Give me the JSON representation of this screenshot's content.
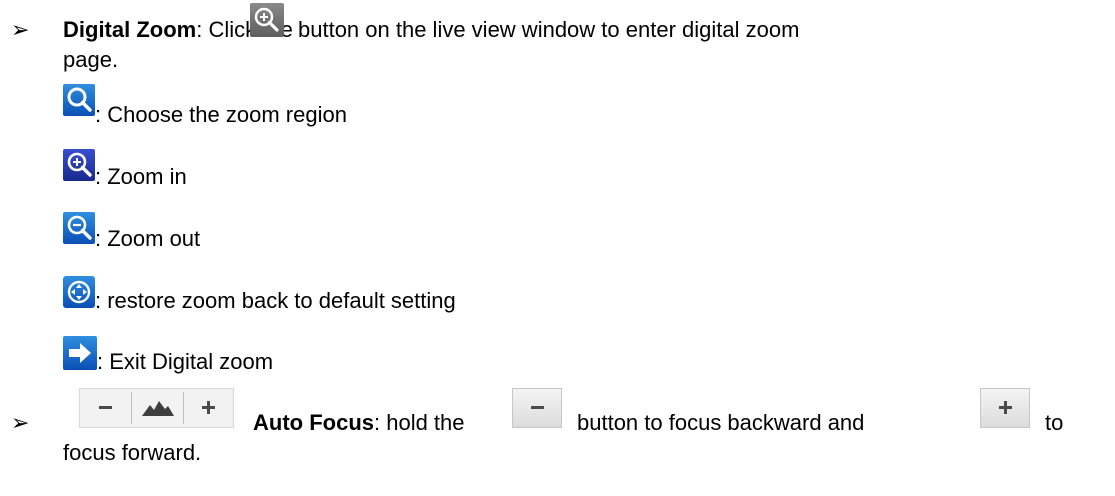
{
  "bullet_symbol": "➢",
  "digital_zoom": {
    "title": "Digital Zoom",
    "intro_pre": ": Click the",
    "intro_post": "button on the live view window to enter digital zoom",
    "intro_wrap": "page.",
    "button_icon": "zoom-in-icon",
    "items": [
      {
        "icon": "zoom-region-icon",
        "text": ": Choose the zoom region"
      },
      {
        "icon": "zoom-in-icon",
        "text": ": Zoom in"
      },
      {
        "icon": "zoom-out-icon",
        "text": ": Zoom out"
      },
      {
        "icon": "restore-icon",
        "text": ": restore zoom back to default setting"
      },
      {
        "icon": "exit-arrow-icon",
        "text": ": Exit Digital zoom"
      }
    ]
  },
  "auto_focus": {
    "title": "Auto Focus",
    "pre": ": hold the",
    "mid": "button to focus backward and",
    "post": "to",
    "wrap": "focus forward.",
    "control_icons": [
      "minus-icon",
      "focus-mountain-icon",
      "plus-icon"
    ]
  },
  "colors": {
    "icon_blue": "#0a4fb5",
    "icon_grey": "#5e5e5e"
  }
}
